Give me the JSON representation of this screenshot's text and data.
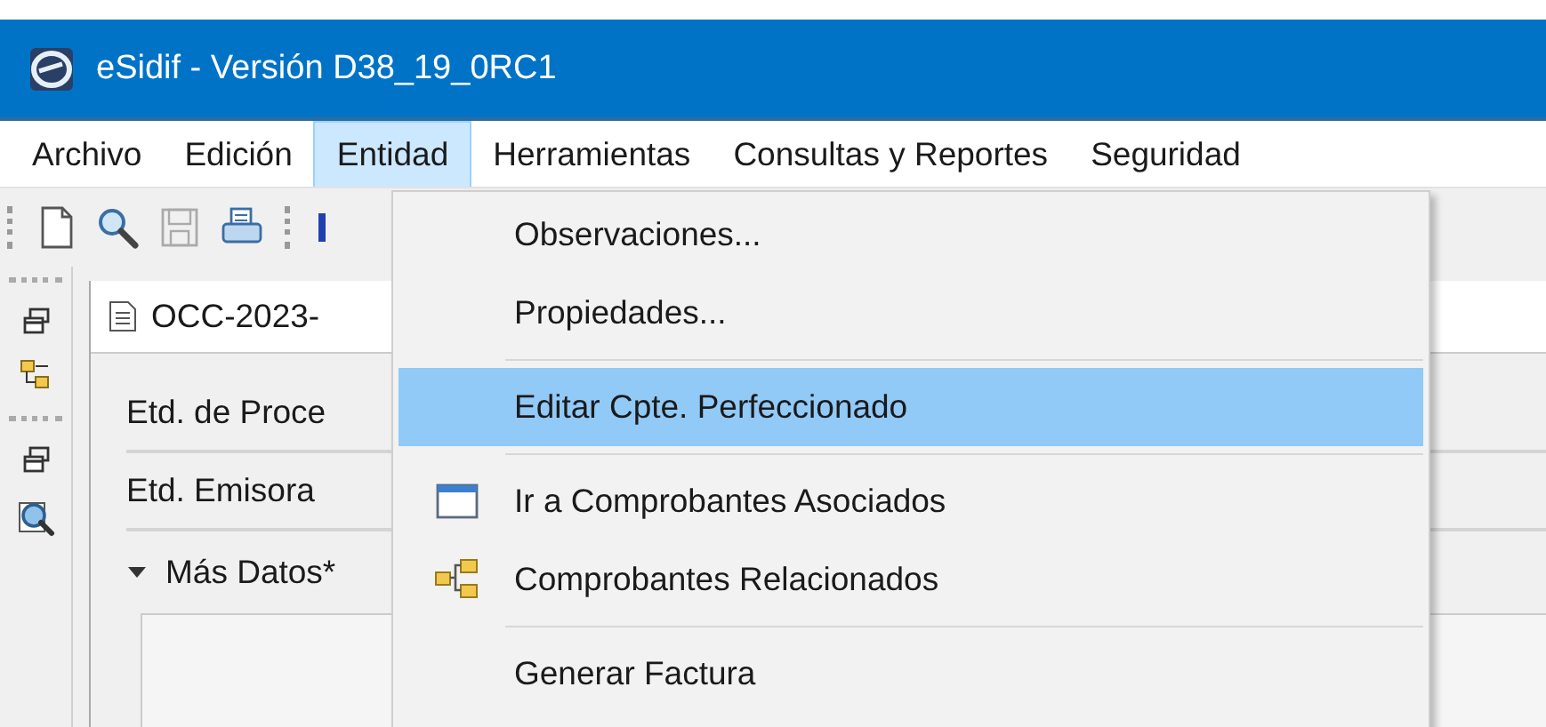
{
  "window": {
    "title": "eSidif - Versión D38_19_0RC1"
  },
  "menu_bar": [
    {
      "label": "Archivo",
      "selected": false
    },
    {
      "label": "Edición",
      "selected": false
    },
    {
      "label": "Entidad",
      "selected": true
    },
    {
      "label": "Herramientas",
      "selected": false
    },
    {
      "label": "Consultas y Reportes",
      "selected": false
    },
    {
      "label": "Seguridad",
      "selected": false
    }
  ],
  "editor": {
    "tab": "OCC-2023-",
    "fields": [
      "Etd. de Proce",
      "Etd. Emisora"
    ],
    "section": {
      "label": "Más Datos*",
      "expanded": true
    }
  },
  "dropdown_menu": [
    {
      "kind": "text",
      "label": "Observaciones...",
      "selected": false
    },
    {
      "kind": "text",
      "label": "Propiedades...",
      "selected": false
    },
    {
      "kind": "separator"
    },
    {
      "kind": "text",
      "label": "Editar Cpte. Perfeccionado",
      "selected": true
    },
    {
      "kind": "separator"
    },
    {
      "kind": "window",
      "label": "Ir a Comprobantes Asociados",
      "selected": false
    },
    {
      "kind": "relations",
      "label": "Comprobantes Relacionados",
      "selected": false
    },
    {
      "kind": "separator"
    },
    {
      "kind": "text",
      "label": "Generar Factura",
      "selected": false
    }
  ]
}
